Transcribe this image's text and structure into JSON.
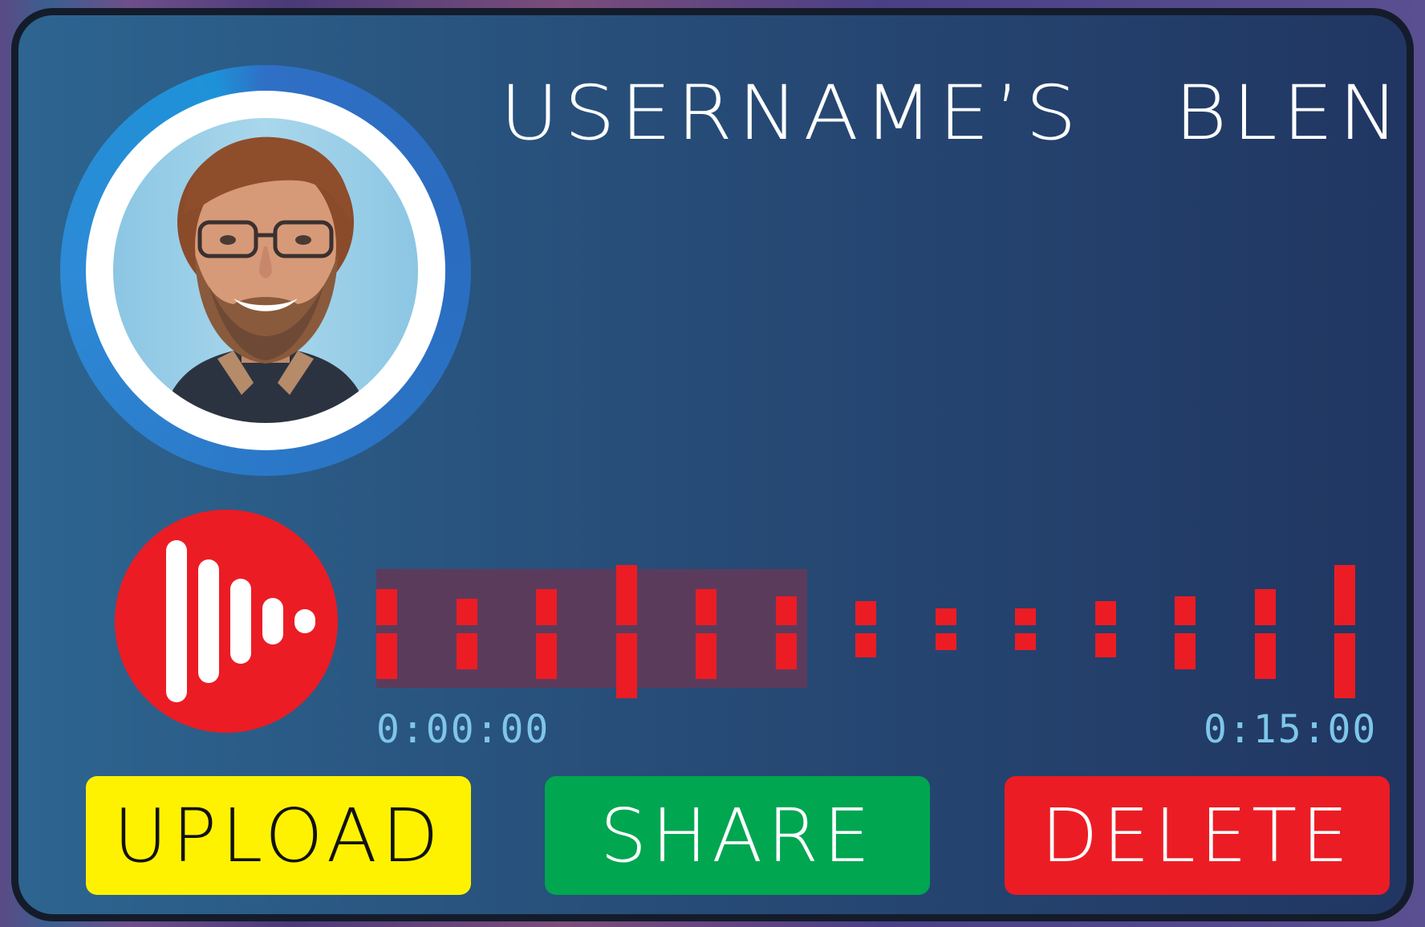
{
  "header": {
    "title": "USERNAME’S   BLEND"
  },
  "avatar": {
    "alt": "User profile photo"
  },
  "recorder": {
    "icon": "audio-waveform-icon",
    "played_fraction": 0.44,
    "bars": [
      {
        "upper": 0.3,
        "lower": 0.38
      },
      {
        "upper": 0.22,
        "lower": 0.3
      },
      {
        "upper": 0.3,
        "lower": 0.38
      },
      {
        "upper": 0.5,
        "lower": 0.54
      },
      {
        "upper": 0.3,
        "lower": 0.38
      },
      {
        "upper": 0.24,
        "lower": 0.3
      },
      {
        "upper": 0.2,
        "lower": 0.2
      },
      {
        "upper": 0.14,
        "lower": 0.14
      },
      {
        "upper": 0.14,
        "lower": 0.14
      },
      {
        "upper": 0.2,
        "lower": 0.2
      },
      {
        "upper": 0.24,
        "lower": 0.3
      },
      {
        "upper": 0.3,
        "lower": 0.38
      },
      {
        "upper": 0.5,
        "lower": 0.54
      }
    ],
    "time_start": "0:00:00",
    "time_end": "0:15:00"
  },
  "actions": {
    "upload_label": "UPLOAD",
    "share_label": "SHARE",
    "delete_label": "DELETE"
  },
  "colors": {
    "card_gradient_start": "#2d6590",
    "card_gradient_end": "#213662",
    "record_red": "#ec1c24",
    "played_region": "#5b3b5c",
    "time_text": "#7ec6ea",
    "upload_yellow": "#fff200",
    "share_green": "#00a650",
    "delete_red": "#ec1c24"
  }
}
